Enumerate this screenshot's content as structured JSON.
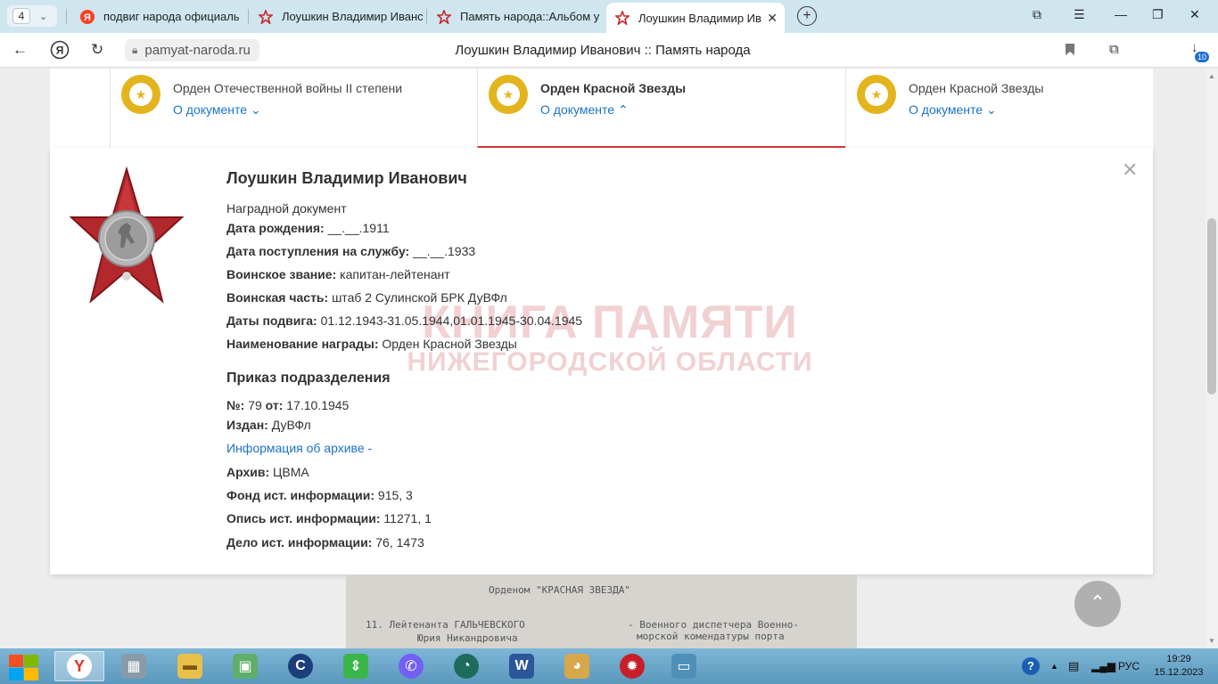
{
  "browser": {
    "tab_count": "4",
    "tabs": [
      {
        "label": "подвиг народа официаль",
        "favicon": "yandex-icon"
      },
      {
        "label": "Лоушкин Владимир Иванс",
        "favicon": "star-icon"
      },
      {
        "label": "Память народа::Альбом у",
        "favicon": "star-icon"
      },
      {
        "label": "Лоушкин Владимир Ив",
        "favicon": "star-icon",
        "active": true
      }
    ],
    "url": "pamyat-naroda.ru",
    "page_title": "Лоушкин Владимир Иванович :: Память народа",
    "download_badge": "10",
    "accent_color": "#cfe6ef"
  },
  "awards": [
    {
      "name": "Орден Отечественной войны II степени",
      "link": "О документе",
      "link_arrow": "⌄"
    },
    {
      "name": "Орден Красной Звезды",
      "link": "О документе",
      "link_arrow": "⌃",
      "selected": true
    },
    {
      "name": "Орден Красной Звезды",
      "link": "О документе",
      "link_arrow": "⌄"
    }
  ],
  "card": {
    "person": "Лоушкин Владимир Иванович",
    "doc_type": "Наградной документ",
    "fields": [
      {
        "label": "Дата рождения:",
        "value": "__.__.1911"
      },
      {
        "label": "Дата поступления на службу:",
        "value": "__.__.1933"
      },
      {
        "label": "Воинское звание:",
        "value": "капитан-лейтенант"
      },
      {
        "label": "Воинская часть:",
        "value": "штаб 2 Сулинской БРК ДуВФл"
      },
      {
        "label": "Даты подвига:",
        "value": "01.12.1943-31.05.1944,01.01.1945-30.04.1945"
      },
      {
        "label": "Наименование награды:",
        "value": "Орден Красной Звезды"
      }
    ],
    "order_section_title": "Приказ подразделения",
    "order_number_label": "№:",
    "order_number": "79",
    "order_date_label": "от:",
    "order_date": "17.10.1945",
    "issued_label": "Издан:",
    "issued_value": "ДуВФл",
    "archive_info_link": "Информация об архиве -",
    "archive_fields": [
      {
        "label": "Архив:",
        "value": "ЦВМА"
      },
      {
        "label": "Фонд ист. информации:",
        "value": "915, 3"
      },
      {
        "label": "Опись ист. информации:",
        "value": "11271, 1"
      },
      {
        "label": "Дело ист. информации:",
        "value": "76, 1473"
      }
    ],
    "watermark_line1": "КНИГА ПАМЯТИ",
    "watermark_line2": "НИЖЕГОРОДСКОЙ ОБЛАСТИ",
    "award_color": "#b3282d"
  },
  "doc_scan": {
    "line1": "Орденом \"КРАСНАЯ ЗВЕЗДА\"",
    "line2": "11. Лейтенанта ГАЛЬЧЕВСКОГО",
    "line3": "Юрия Никандровича",
    "line4": "- Военного диспетчера Военно-",
    "line5": "морской комендатуры порта"
  },
  "taskbar": {
    "language": "РУС",
    "time": "19:29",
    "date": "15.12.2023"
  }
}
